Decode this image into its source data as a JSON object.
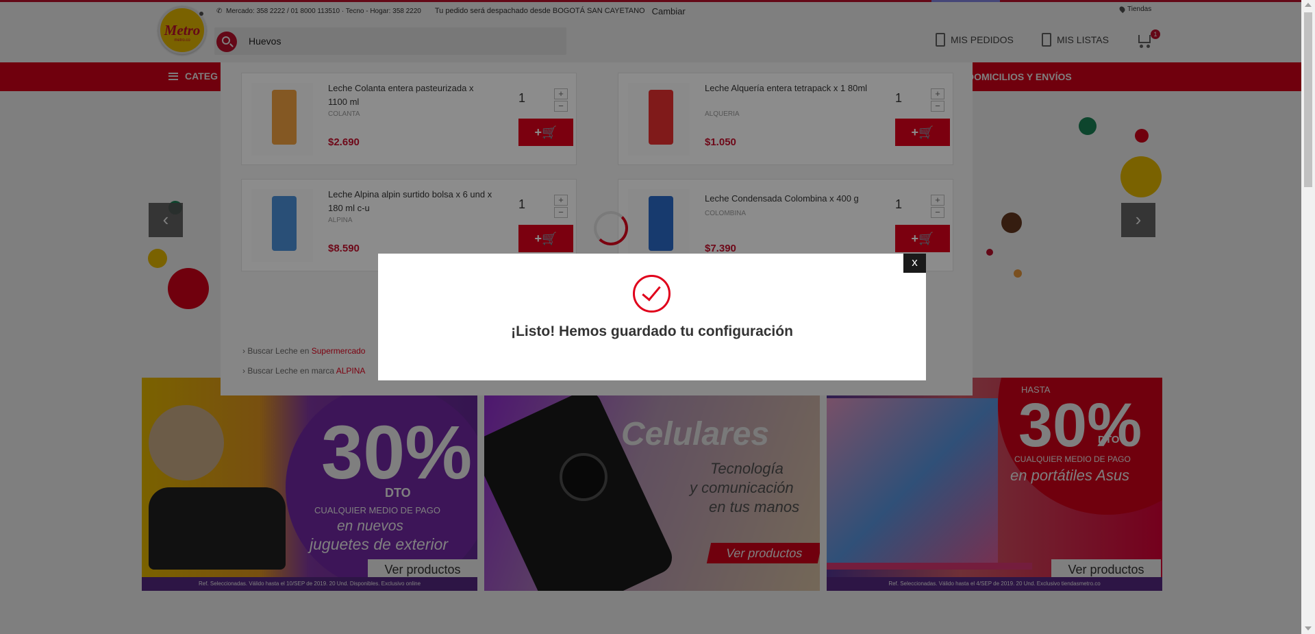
{
  "header": {
    "logo": {
      "text": "Metro",
      "sub": "metro.co"
    },
    "info": {
      "phones": "Mercado: 358 2222 / 01 8000 113510 · Tecno - Hogar: 358 2220",
      "store_text": "Tu pedido será despachado desde BOGOTÁ SAN CAYETANO",
      "change_label": "Cambiar"
    },
    "stores_label": "Tiendas",
    "search": {
      "value": "Huevos",
      "placeholder": ""
    },
    "my_orders_label": "MIS PEDIDOS",
    "my_lists_label": "MIS LISTAS",
    "cart_count": "1"
  },
  "nav": {
    "categories_label": "CATEG",
    "delivery_label": "DOMICILIOS Y ENVÍOS"
  },
  "results": {
    "products": [
      {
        "name": "Leche Colanta entera pasteurizada x 1100 ml",
        "brand": "COLANTA",
        "price": "$2.690",
        "qty": "1",
        "color": "#f0a040"
      },
      {
        "name": "Leche Alquería entera tetrapack x 1 80ml",
        "brand": "ALQUERIA",
        "price": "$1.050",
        "qty": "1",
        "color": "#e83030"
      },
      {
        "name": "Leche Alpina alpin surtido bolsa x 6 und x 180 ml c-u",
        "brand": "ALPINA",
        "price": "$8.590",
        "qty": "1",
        "color": "#4a90d9"
      },
      {
        "name": "Leche Condensada Colombina x 400 g",
        "brand": "COLOMBINA",
        "price": "$7.390",
        "qty": "1",
        "color": "#2a6ac8"
      }
    ],
    "add_label": "+",
    "plus_label": "+",
    "minus_label": "−",
    "suggest1": {
      "prefix": "Buscar Leche en ",
      "link": "Supermercado"
    },
    "suggest2": {
      "prefix": "Buscar Leche en marca ",
      "link": "ALPINA"
    }
  },
  "banners": {
    "b1": {
      "pct": "30%",
      "dto": "DTO",
      "l1": "CUALQUIER MEDIO DE PAGO",
      "l2": "en nuevos",
      "l3": "juguetes de exterior",
      "cta": "Ver productos",
      "fine": "Ref. Seleccionadas. Válido hasta el 10/SEP de 2019. 20 Und. Disponibles. Exclusivo online"
    },
    "b2": {
      "title": "Celulares",
      "l1": "Tecnología",
      "l2": "y comunicación",
      "l3": "en tus manos",
      "cta": "Ver productos"
    },
    "b3": {
      "top": "HASTA",
      "pct": "30%",
      "dto": "DTO",
      "l1": "CUALQUIER MEDIO DE PAGO",
      "l2": "en portátiles Asus",
      "cta": "Ver productos",
      "fine": "Ref. Seleccionadas. Válido hasta el 4/SEP de 2019. 20 Und. Exclusivo tiendasmetro.co"
    }
  },
  "carousel": {
    "prev_label": "‹",
    "next_label": "›"
  },
  "modal": {
    "message": "¡Listo! Hemos guardado tu configuración",
    "close_label": "x"
  },
  "colors": {
    "brand_red": "#e0001b",
    "brand_yellow": "#f5c400"
  }
}
